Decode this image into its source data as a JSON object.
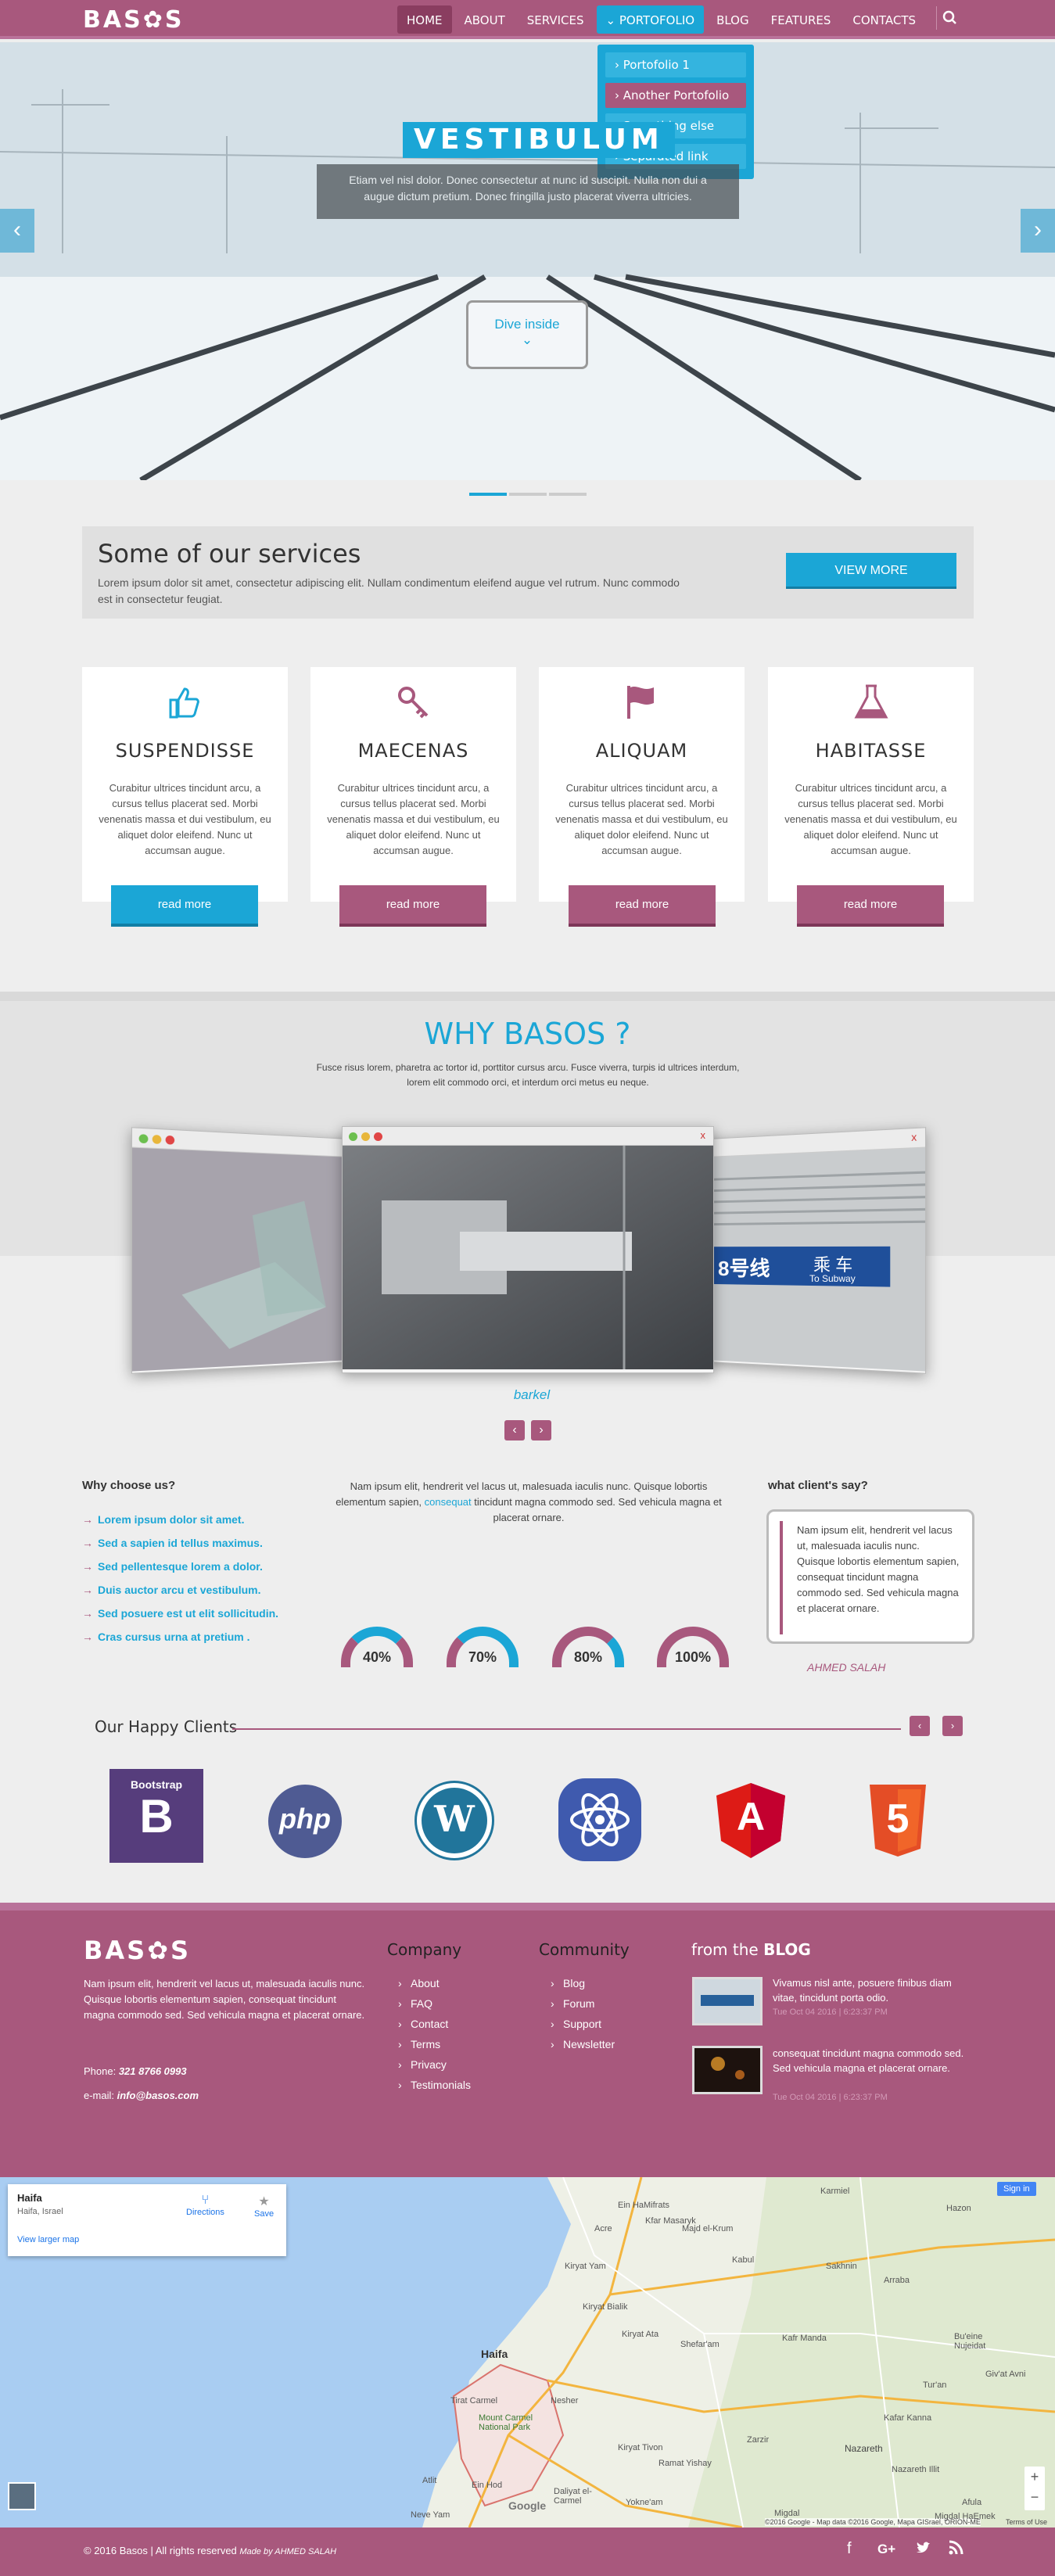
{
  "nav": {
    "logo": "BAS✿S",
    "items": [
      "HOME",
      "ABOUT",
      "SERVICES",
      "PORTOFOLIO",
      "BLOG",
      "FEATURES",
      "CONTACTS"
    ],
    "dropdown": [
      "Portofolio 1",
      "Another Portofolio",
      "Something else here",
      "Separated link"
    ]
  },
  "hero": {
    "title": "VESTIBULUM",
    "text": "Etiam vel nisl dolor. Donec consectetur at nunc id suscipit. Nulla non dui a augue dictum pretium. Donec fringilla justo placerat viverra ultricies.",
    "button": "Dive inside",
    "active_slide": 1,
    "slides_count": 3
  },
  "services": {
    "title": "Some of our services",
    "text": "Lorem ipsum dolor sit amet, consectetur adipiscing elit. Nullam condimentum eleifend augue vel rutrum. Nunc commodo est in consectetur feugiat.",
    "button": "VIEW MORE",
    "cards": [
      {
        "icon": "thumbs-up-icon",
        "title": "SUSPENDISSE",
        "text": "Curabitur ultrices tincidunt arcu, a cursus tellus placerat sed. Morbi venenatis massa et dui vestibulum, eu aliquet dolor eleifend. Nunc ut accumsan augue.",
        "button": "read more"
      },
      {
        "icon": "key-icon",
        "title": "MAECENAS",
        "text": "Curabitur ultrices tincidunt arcu, a cursus tellus placerat sed. Morbi venenatis massa et dui vestibulum, eu aliquet dolor eleifend. Nunc ut accumsan augue.",
        "button": "read more"
      },
      {
        "icon": "flag-icon",
        "title": "ALIQUAM",
        "text": "Curabitur ultrices tincidunt arcu, a cursus tellus placerat sed. Morbi venenatis massa et dui vestibulum, eu aliquet dolor eleifend. Nunc ut accumsan augue.",
        "button": "read more"
      },
      {
        "icon": "flask-icon",
        "title": "HABITASSE",
        "text": "Curabitur ultrices tincidunt arcu, a cursus tellus placerat sed. Morbi venenatis massa et dui vestibulum, eu aliquet dolor eleifend. Nunc ut accumsan augue.",
        "button": "read more"
      }
    ]
  },
  "why": {
    "title": "WHY BASOS ?",
    "text": "Fusce risus lorem, pharetra ac tortor id, porttitor cursus arcu. Fusce viverra, turpis id ultrices interdum, lorem elit commodo orci, et interdum orci metus eu neque.",
    "slider_label": "barkel",
    "sign_cn": "乘 车",
    "sign_en": "To Subway",
    "sign_line": "8号线"
  },
  "choose": {
    "title": "Why choose us?",
    "items": [
      "Lorem ipsum dolor sit amet.",
      "Sed a sapien id tellus maximus.",
      "Sed pellentesque lorem a dolor.",
      "Duis auctor arcu et vestibulum.",
      "Sed posuere est ut elit sollicitudin.",
      "Cras cursus urna at pretium ."
    ],
    "text_a": "Nam ipsum elit, hendrerit vel lacus ut, malesuada iaculis nunc. Quisque lobortis elementum sapien, ",
    "text_link": "consequat",
    "text_b": " tincidunt magna commodo sed. Sed vehicula magna et placerat ornare.",
    "gauges": [
      {
        "label": "40%",
        "value": 40
      },
      {
        "label": "70%",
        "value": 70
      },
      {
        "label": "80%",
        "value": 80
      },
      {
        "label": "100%",
        "value": 100
      }
    ],
    "say_title": "what client's say?",
    "quote": "Nam ipsum elit, hendrerit vel lacus ut, malesuada iaculis nunc. Quisque lobortis elementum sapien, consequat tincidunt magna commodo sed. Sed vehicula magna et placerat ornare.",
    "author": "AHMED SALAH"
  },
  "clients": {
    "title": "Our Happy Clients",
    "logos": [
      {
        "name": "bootstrap-logo",
        "text": "Bootstrap"
      },
      {
        "name": "php-logo",
        "text": "php"
      },
      {
        "name": "wordpress-logo",
        "text": "W"
      },
      {
        "name": "react-logo",
        "text": ""
      },
      {
        "name": "angular-logo",
        "text": "A"
      },
      {
        "name": "html5-logo",
        "text": "5"
      }
    ]
  },
  "footer": {
    "logo": "BAS✿S",
    "about": "Nam ipsum elit, hendrerit vel lacus ut, malesuada iaculis nunc. Quisque lobortis elementum sapien, consequat tincidunt magna commodo sed. Sed vehicula magna et placerat ornare.",
    "phone_label": "Phone: ",
    "phone": "321 8766 0993",
    "email_label": "e-mail: ",
    "email": "info@basos.com",
    "company_title": "Company",
    "company": [
      "About",
      "FAQ",
      "Contact",
      "Terms",
      "Privacy",
      "Testimonials"
    ],
    "community_title": "Community",
    "community": [
      "Blog",
      "Forum",
      "Support",
      "Newsletter"
    ],
    "blog_prefix": "from the ",
    "blog_bold": "BLOG",
    "posts": [
      {
        "text": "Vivamus nisl ante, posuere finibus diam vitae, tincidunt porta odio.",
        "date": "Tue Oct 04 2016 | 6:23:37 PM"
      },
      {
        "text": "consequat tincidunt magna commodo sed. Sed vehicula magna et placerat ornare.",
        "date": "Tue Oct 04 2016 | 6:23:37 PM"
      }
    ]
  },
  "map": {
    "place": "Haifa",
    "sub": "Haifa, Israel",
    "directions": "Directions",
    "save": "Save",
    "larger": "View larger map",
    "signin": "Sign in",
    "attribution": "©2016 Google - Map data ©2016 Google, Mapa GISrael, ORION-ME",
    "terms": "Terms of Use",
    "google": "Google",
    "cities": [
      "Karmiel",
      "Hazon",
      "Majd el-Krum",
      "Kabul",
      "Sakhnin",
      "Arraba",
      "Kafr Manda",
      "Tur'an",
      "Kafar Kanna",
      "Nazareth",
      "Nazareth Illit",
      "Migdal",
      "Afula",
      "Haifa",
      "Kiryat Ata",
      "Kiryat Bialik",
      "Acre",
      "Shefar'am",
      "Nesher",
      "Mount Carmel National Park",
      "Tirat Carmel",
      "Kiryat Tivon",
      "Ein Hod",
      "Daliyat el-Carmel",
      "Ramat Yishay",
      "Zarzir",
      "Yokne'am",
      "Atlit",
      "Neve Yam",
      "Migdal HaEmek",
      "Giv'at Avni",
      "Bu'eine Nujeidat",
      "Kiryat Yam",
      "Ein HaMifrats",
      "Kfar Masaryk"
    ]
  },
  "bottom": {
    "copy": "© 2016 Basos | All rights reserved ",
    "made": "Made by AHMED SALAH",
    "social": [
      "facebook-icon",
      "google-plus-icon",
      "twitter-icon",
      "rss-icon"
    ]
  },
  "colors": {
    "brand": "#a8587d",
    "accent": "#1ba6d6",
    "background": "#eeeeee"
  }
}
